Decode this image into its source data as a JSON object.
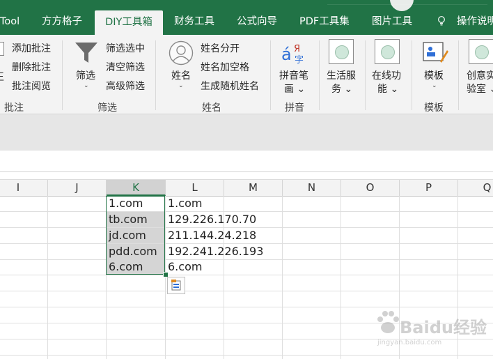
{
  "tabs": [
    {
      "label": "Tool",
      "active": false
    },
    {
      "label": "方方格子",
      "active": false
    },
    {
      "label": "DIY工具箱",
      "active": true
    },
    {
      "label": "财务工具",
      "active": false
    },
    {
      "label": "公式向导",
      "active": false
    },
    {
      "label": "PDF工具集",
      "active": false
    },
    {
      "label": "图片工具",
      "active": false
    },
    {
      "label": "操作说明",
      "active": false
    }
  ],
  "ribbon": {
    "pizhu": {
      "edge_char": "王",
      "add": "添加批注",
      "delete": "删除批注",
      "review": "批注阅览",
      "group": "批注"
    },
    "shaixuan": {
      "big": "筛选",
      "caret": "⌄",
      "select": "筛选选中",
      "clear": "清空筛选",
      "advanced": "高级筛选",
      "group": "筛选"
    },
    "xingming": {
      "big": "姓名",
      "caret": "⌄",
      "split": "姓名分开",
      "addspace": "姓名加空格",
      "random": "生成随机姓名",
      "group": "姓名"
    },
    "pinyin": {
      "big_l1": "拼音笔",
      "big_l2": "画 ⌄",
      "group": "拼音"
    },
    "life": {
      "l1": "生活服",
      "l2": "务 ⌄"
    },
    "online": {
      "l1": "在线功",
      "l2": "能 ⌄"
    },
    "template": {
      "big": "模板",
      "caret": "⌄",
      "group": "模板"
    },
    "lab": {
      "l1": "创意实",
      "l2": "验室 ⌄"
    }
  },
  "columns": [
    "I",
    "J",
    "K",
    "L",
    "M",
    "N",
    "O",
    "P",
    "Q"
  ],
  "rows": [
    {
      "k": "1.com",
      "l": "1.com"
    },
    {
      "k": "tb.com",
      "l": "129.226.170.70"
    },
    {
      "k": "jd.com",
      "l": "211.144.24.218"
    },
    {
      "k": "pdd.com",
      "l": "192.241.226.193"
    },
    {
      "k": "6.com",
      "l": "6.com"
    }
  ],
  "watermark": {
    "text": "Baidu经验",
    "sub": "jingyan.baidu.com"
  },
  "colors": {
    "accent": "#217346"
  }
}
